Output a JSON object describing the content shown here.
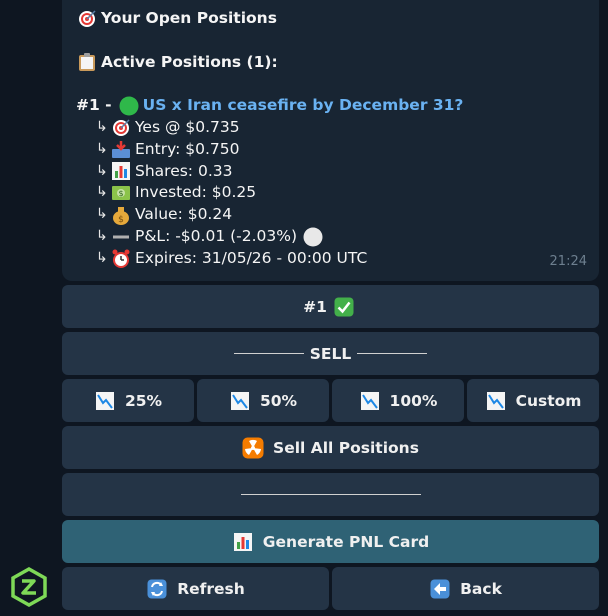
{
  "message": {
    "header": "Your Open Positions",
    "active_label": "Active Positions (1):",
    "position": {
      "index": "#1 -",
      "market": "US x Iran ceasefire by December 31?",
      "details": [
        {
          "icon": "target-icon",
          "text": "Yes @ $0.735"
        },
        {
          "icon": "inbox-tray-icon",
          "text": "Entry: $0.750"
        },
        {
          "icon": "bar-chart-icon",
          "text": "Shares: 0.33"
        },
        {
          "icon": "dollar-banknote-icon",
          "text": "Invested: $0.25"
        },
        {
          "icon": "money-bag-icon",
          "text": "Value: $0.24"
        },
        {
          "icon": "minus-icon",
          "text": "P&L: -$0.01 (-2.03%)"
        },
        {
          "icon": "alarm-clock-icon",
          "text": "Expires: 31/05/26 - 00:00 UTC"
        }
      ]
    },
    "time": "21:24"
  },
  "keyboard": {
    "position_select": "#1",
    "sell_label": "SELL",
    "sell_options": [
      "25%",
      "50%",
      "100%",
      "Custom"
    ],
    "sell_all": "Sell All Positions",
    "generate_pnl": "Generate PNL Card",
    "refresh": "Refresh",
    "back": "Back"
  },
  "colors": {
    "background": "#0e1621",
    "bubble": "#182533",
    "button": "#243446",
    "button_accent": "#2f6275",
    "link": "#6ab2f2"
  }
}
